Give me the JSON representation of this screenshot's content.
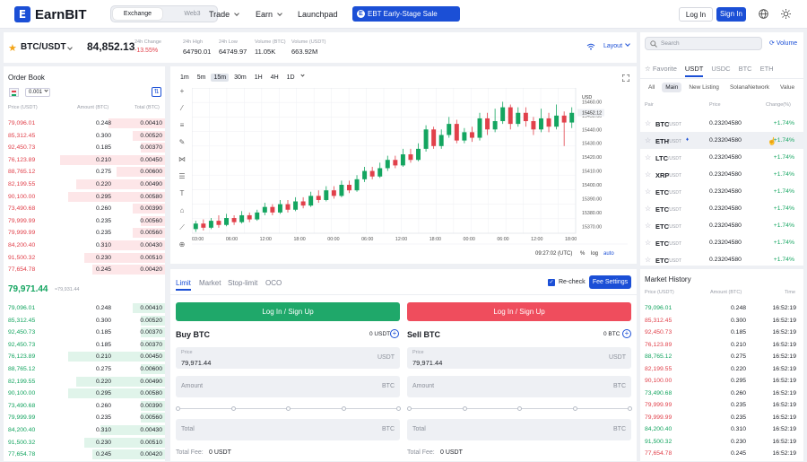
{
  "header": {
    "logo": "EarnBIT",
    "seg_exchange": "Exchange",
    "seg_web3": "Web3",
    "nav_trade": "Trade",
    "nav_earn": "Earn",
    "nav_launchpad": "Launchpad",
    "sale": "EBT Early-Stage Sale",
    "login": "Log In",
    "signin": "Sign In"
  },
  "ticker": {
    "pair": "BTC/USDT",
    "price": "84,852.13",
    "change_label": "24h Change",
    "change": "-13.55%",
    "high_label": "24h High",
    "high": "64790.01",
    "low_label": "24h Low",
    "low": "64749.97",
    "vol_btc_label": "Volume (BTC)",
    "vol_btc": "11.05K",
    "vol_usdt_label": "Volume (USDT)",
    "vol_usdt": "663.92M",
    "layout": "Layout"
  },
  "orderbook": {
    "title": "Order Book",
    "precision": "0.001",
    "col_price": "Price (USDT)",
    "col_amount": "Amount (BTC)",
    "col_total": "Total (BTC)",
    "asks": [
      {
        "price": "79,096.01",
        "amount": "0.248",
        "total": "0.00410",
        "depth": 0.35
      },
      {
        "price": "85,312.45",
        "amount": "0.300",
        "total": "0.00520",
        "depth": 0.2
      },
      {
        "price": "92,450.73",
        "amount": "0.185",
        "total": "0.00370",
        "depth": 0.15
      },
      {
        "price": "76,123.89",
        "amount": "0.210",
        "total": "0.00450",
        "depth": 0.65
      },
      {
        "price": "88,765.12",
        "amount": "0.275",
        "total": "0.00600",
        "depth": 0.3
      },
      {
        "price": "82,199.55",
        "amount": "0.220",
        "total": "0.00490",
        "depth": 0.55
      },
      {
        "price": "90,100.00",
        "amount": "0.295",
        "total": "0.00580",
        "depth": 0.6
      },
      {
        "price": "73,490.68",
        "amount": "0.260",
        "total": "0.00390",
        "depth": 0.2
      },
      {
        "price": "79,999.99",
        "amount": "0.235",
        "total": "0.00560",
        "depth": 0.15
      },
      {
        "price": "79,999.99",
        "amount": "0.235",
        "total": "0.00560",
        "depth": 0.2
      },
      {
        "price": "84,200.40",
        "amount": "0.310",
        "total": "0.00430",
        "depth": 0.4
      },
      {
        "price": "91,500.32",
        "amount": "0.230",
        "total": "0.00510",
        "depth": 0.5
      },
      {
        "price": "77,654.78",
        "amount": "0.245",
        "total": "0.00420",
        "depth": 0.45
      }
    ],
    "mid_price": "79,971.44",
    "mid_sub": "≈79,931.44",
    "bids": [
      {
        "price": "79,096.01",
        "amount": "0.248",
        "total": "0.00410",
        "depth": 0.2
      },
      {
        "price": "85,312.45",
        "amount": "0.300",
        "total": "0.00520",
        "depth": 0.15
      },
      {
        "price": "92,450.73",
        "amount": "0.185",
        "total": "0.00370",
        "depth": 0.15
      },
      {
        "price": "92,450.73",
        "amount": "0.185",
        "total": "0.00370",
        "depth": 0.15
      },
      {
        "price": "76,123.89",
        "amount": "0.210",
        "total": "0.00450",
        "depth": 0.6
      },
      {
        "price": "88,765.12",
        "amount": "0.275",
        "total": "0.00600",
        "depth": 0.15
      },
      {
        "price": "82,199.55",
        "amount": "0.220",
        "total": "0.00490",
        "depth": 0.55
      },
      {
        "price": "90,100.00",
        "amount": "0.295",
        "total": "0.00580",
        "depth": 0.6
      },
      {
        "price": "73,490.68",
        "amount": "0.260",
        "total": "0.00390",
        "depth": 0.15
      },
      {
        "price": "79,999.99",
        "amount": "0.235",
        "total": "0.00560",
        "depth": 0.15
      },
      {
        "price": "84,200.40",
        "amount": "0.310",
        "total": "0.00430",
        "depth": 0.4
      },
      {
        "price": "91,500.32",
        "amount": "0.230",
        "total": "0.00510",
        "depth": 0.5
      },
      {
        "price": "77,654.78",
        "amount": "0.245",
        "total": "0.00420",
        "depth": 0.45
      }
    ]
  },
  "chart": {
    "intervals": [
      "1m",
      "5m",
      "15m",
      "30m",
      "1H",
      "4H",
      "1D"
    ],
    "active_interval": "15m",
    "currency": "USD",
    "time_readout": "09:27:02 (UTC)",
    "pct": "%",
    "log": "log",
    "auto": "auto",
    "colors": {
      "up": "#14a560",
      "down": "#e1414b"
    }
  },
  "chart_data": {
    "type": "candlestick",
    "xticks": [
      "03:00",
      "06:00",
      "12:00",
      "18:00",
      "00:00",
      "06:00",
      "12:00",
      "18:00",
      "00:00",
      "06:00",
      "12:00",
      "18:00"
    ],
    "yticks": [
      "15460.00",
      "15450.00",
      "15440.00",
      "15430.00",
      "15420.00",
      "15410.00",
      "15400.00",
      "15390.00",
      "15380.00",
      "15370.00"
    ],
    "price_tag": "15452.12",
    "ylim": [
      15365,
      15470
    ],
    "candles": [
      [
        15368,
        15372,
        15374,
        15366
      ],
      [
        15372,
        15369,
        15375,
        15367
      ],
      [
        15369,
        15374,
        15376,
        15368
      ],
      [
        15374,
        15371,
        15378,
        15369
      ],
      [
        15371,
        15376,
        15379,
        15370
      ],
      [
        15376,
        15373,
        15378,
        15371
      ],
      [
        15373,
        15378,
        15381,
        15372
      ],
      [
        15378,
        15375,
        15380,
        15373
      ],
      [
        15375,
        15380,
        15382,
        15374
      ],
      [
        15380,
        15384,
        15387,
        15378
      ],
      [
        15384,
        15380,
        15386,
        15378
      ],
      [
        15380,
        15386,
        15389,
        15379
      ],
      [
        15386,
        15382,
        15389,
        15380
      ],
      [
        15382,
        15388,
        15391,
        15381
      ],
      [
        15388,
        15385,
        15391,
        15383
      ],
      [
        15385,
        15392,
        15395,
        15384
      ],
      [
        15392,
        15389,
        15396,
        15387
      ],
      [
        15389,
        15396,
        15399,
        15388
      ],
      [
        15396,
        15392,
        15399,
        15390
      ],
      [
        15392,
        15400,
        15403,
        15391
      ],
      [
        15400,
        15396,
        15403,
        15394
      ],
      [
        15396,
        15404,
        15407,
        15395
      ],
      [
        15404,
        15410,
        15413,
        15402
      ],
      [
        15410,
        15406,
        15413,
        15404
      ],
      [
        15406,
        15412,
        15416,
        15405
      ],
      [
        15412,
        15418,
        15421,
        15410
      ],
      [
        15418,
        15414,
        15421,
        15412
      ],
      [
        15414,
        15422,
        15426,
        15413
      ],
      [
        15422,
        15418,
        15426,
        15416
      ],
      [
        15418,
        15426,
        15430,
        15417
      ],
      [
        15426,
        15440,
        15443,
        15424
      ],
      [
        15440,
        15428,
        15442,
        15426
      ],
      [
        15428,
        15436,
        15440,
        15426
      ],
      [
        15436,
        15444,
        15449,
        15434
      ],
      [
        15444,
        15432,
        15447,
        15430
      ],
      [
        15432,
        15438,
        15441,
        15430
      ],
      [
        15438,
        15434,
        15442,
        15431
      ],
      [
        15434,
        15448,
        15452,
        15432
      ],
      [
        15448,
        15440,
        15452,
        15436
      ],
      [
        15440,
        15446,
        15455,
        15438
      ],
      [
        15446,
        15456,
        15460,
        15444
      ],
      [
        15456,
        15444,
        15458,
        15440
      ],
      [
        15444,
        15452,
        15456,
        15442
      ],
      [
        15452,
        15446,
        15456,
        15442
      ],
      [
        15446,
        15440,
        15449,
        15436
      ],
      [
        15440,
        15448,
        15455,
        15438
      ],
      [
        15448,
        15442,
        15452,
        15438
      ],
      [
        15442,
        15450,
        15458,
        15440
      ],
      [
        15450,
        15445,
        15453,
        15428
      ],
      [
        15445,
        15452,
        15456,
        15441
      ]
    ]
  },
  "trade": {
    "tab_limit": "Limit",
    "tab_market": "Market",
    "tab_stop": "Stop-limit",
    "tab_oco": "OCO",
    "recheck": "Re-check",
    "fee_settings": "Fee Settings",
    "buy_login": "Log In / Sign Up",
    "sell_login": "Log In / Sign Up",
    "buy_title": "Buy BTC",
    "buy_balance": "0 USDT",
    "sell_title": "Sell BTC",
    "sell_balance": "0 BTC",
    "price_label": "Price",
    "price_value": "79,971.44",
    "price_unit": "USDT",
    "amount_placeholder": "Amount",
    "amount_unit": "BTC",
    "total_placeholder": "Total",
    "total_unit": "USDT",
    "total_fee_label": "Total Fee:",
    "total_fee_buy": "0 USDT",
    "total_fee_sell": "0 USDT"
  },
  "markets": {
    "search_placeholder": "Search",
    "volume": "Volume",
    "tabs": [
      "Favorite",
      "USDT",
      "USDC",
      "BTC",
      "ETH"
    ],
    "active_tab": "USDT",
    "subtabs": [
      "All",
      "Main",
      "New Listing",
      "SolanaNetwork",
      "Value"
    ],
    "active_subtab": "Main",
    "col_pair": "Pair",
    "col_price": "Price",
    "col_change": "Change(%)",
    "rows": [
      {
        "base": "BTC",
        "quote": "/USDT",
        "price": "0.23204580",
        "change": "+1.74%"
      },
      {
        "base": "ETH",
        "quote": "/USDT",
        "price": "0.23204580",
        "change": "+1.74%"
      },
      {
        "base": "LTC",
        "quote": "/USDT",
        "price": "0.23204580",
        "change": "+1.74%"
      },
      {
        "base": "XRP",
        "quote": "/USDT",
        "price": "0.23204580",
        "change": "+1.74%"
      },
      {
        "base": "ETC",
        "quote": "/USDT",
        "price": "0.23204580",
        "change": "+1.74%"
      },
      {
        "base": "ETC",
        "quote": "/USDT",
        "price": "0.23204580",
        "change": "+1.74%"
      },
      {
        "base": "ETC",
        "quote": "/USDT",
        "price": "0.23204580",
        "change": "+1.74%"
      },
      {
        "base": "ETC",
        "quote": "/USDT",
        "price": "0.23204580",
        "change": "+1.74%"
      },
      {
        "base": "ETC",
        "quote": "/USDT",
        "price": "0.23204580",
        "change": "+1.74%"
      }
    ]
  },
  "history": {
    "title": "Market History",
    "col_price": "Price (USDT)",
    "col_amount": "Amount (BTC)",
    "col_time": "Time",
    "rows": [
      {
        "price": "79,096.01",
        "amount": "0.248",
        "time": "16:52:19",
        "side": "buy"
      },
      {
        "price": "85,312.45",
        "amount": "0.300",
        "time": "16:52:19",
        "side": "sell"
      },
      {
        "price": "92,450.73",
        "amount": "0.185",
        "time": "16:52:19",
        "side": "sell"
      },
      {
        "price": "76,123.89",
        "amount": "0.210",
        "time": "16:52:19",
        "side": "sell"
      },
      {
        "price": "88,765.12",
        "amount": "0.275",
        "time": "16:52:19",
        "side": "buy"
      },
      {
        "price": "82,199.55",
        "amount": "0.220",
        "time": "16:52:19",
        "side": "sell"
      },
      {
        "price": "90,100.00",
        "amount": "0.295",
        "time": "16:52:19",
        "side": "sell"
      },
      {
        "price": "73,490.68",
        "amount": "0.260",
        "time": "16:52:19",
        "side": "buy"
      },
      {
        "price": "79,999.99",
        "amount": "0.235",
        "time": "16:52:19",
        "side": "sell"
      },
      {
        "price": "79,999.99",
        "amount": "0.235",
        "time": "16:52:19",
        "side": "sell"
      },
      {
        "price": "84,200.40",
        "amount": "0.310",
        "time": "16:52:19",
        "side": "buy"
      },
      {
        "price": "91,500.32",
        "amount": "0.230",
        "time": "16:52:19",
        "side": "buy"
      },
      {
        "price": "77,654.78",
        "amount": "0.245",
        "time": "16:52:19",
        "side": "sell"
      }
    ]
  }
}
